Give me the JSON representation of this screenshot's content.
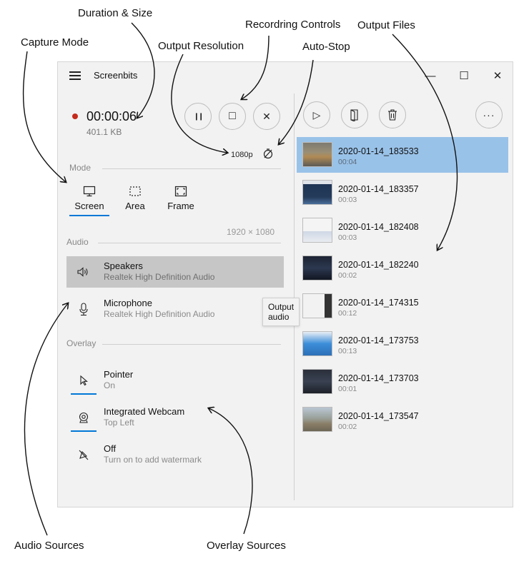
{
  "annotations": {
    "duration_size": "Duration & Size",
    "recording_controls": "Recordring Controls",
    "output_files": "Output Files",
    "capture_mode": "Capture Mode",
    "output_resolution": "Output Resolution",
    "auto_stop": "Auto-Stop",
    "audio_sources": "Audio Sources",
    "overlay_sources": "Overlay Sources"
  },
  "window": {
    "title": "Screenbits",
    "controls": {
      "minimize": "—",
      "maximize": "☐",
      "close": "✕"
    }
  },
  "recording": {
    "duration": "00:00:06",
    "size": "401.1 KB",
    "status_color": "#c42b1c",
    "resolution": "1080p",
    "controls": [
      {
        "name": "pause",
        "icon": "pause-icon",
        "glyph": "❙❙"
      },
      {
        "name": "stop",
        "icon": "stop-icon",
        "glyph": "□"
      },
      {
        "name": "cancel",
        "icon": "close-icon",
        "glyph": "✕"
      }
    ]
  },
  "mode": {
    "label": "Mode",
    "tabs": [
      {
        "label": "Screen",
        "icon": "monitor-icon",
        "selected": true
      },
      {
        "label": "Area",
        "icon": "area-select-icon",
        "selected": false
      },
      {
        "label": "Frame",
        "icon": "frame-icon",
        "selected": false
      }
    ],
    "screen_resolution": "1920 × 1080"
  },
  "audio": {
    "label": "Audio",
    "sources": [
      {
        "title": "Speakers",
        "subtitle": "Realtek High Definition Audio",
        "icon": "speaker-icon",
        "selected": true
      },
      {
        "title": "Microphone",
        "subtitle": "Realtek High Definition Audio",
        "icon": "microphone-icon",
        "selected": false
      }
    ],
    "tooltip": "Output audio"
  },
  "overlay": {
    "label": "Overlay",
    "sources": [
      {
        "title": "Pointer",
        "subtitle": "On",
        "icon": "pointer-icon",
        "active": true
      },
      {
        "title": "Integrated Webcam",
        "subtitle": "Top Left",
        "icon": "webcam-icon",
        "active": true
      },
      {
        "title": "Off",
        "subtitle": "Turn on to add watermark",
        "icon": "watermark-off-icon",
        "active": false
      }
    ]
  },
  "toolbar": {
    "play": "▷",
    "more": "···"
  },
  "files": [
    {
      "name": "2020-01-14_183533",
      "duration": "00:04",
      "selected": true
    },
    {
      "name": "2020-01-14_183357",
      "duration": "00:03",
      "selected": false
    },
    {
      "name": "2020-01-14_182408",
      "duration": "00:03",
      "selected": false
    },
    {
      "name": "2020-01-14_182240",
      "duration": "00:02",
      "selected": false
    },
    {
      "name": "2020-01-14_174315",
      "duration": "00:12",
      "selected": false
    },
    {
      "name": "2020-01-14_173753",
      "duration": "00:13",
      "selected": false
    },
    {
      "name": "2020-01-14_173703",
      "duration": "00:01",
      "selected": false
    },
    {
      "name": "2020-01-14_173547",
      "duration": "00:02",
      "selected": false
    }
  ],
  "colors": {
    "accent": "#0078d7",
    "selected_file": "#99c2e8",
    "selected_source": "#c6c6c6"
  }
}
